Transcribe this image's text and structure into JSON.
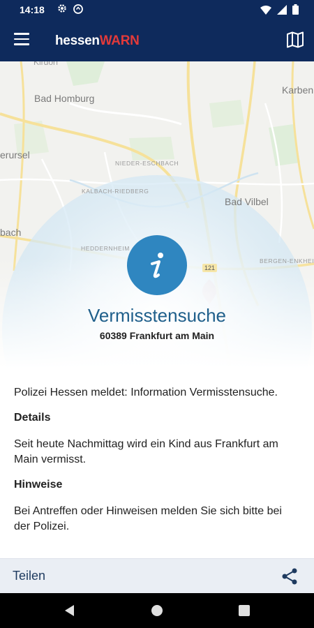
{
  "status_bar": {
    "time": "14:18"
  },
  "app_bar": {
    "logo_part1": "hessen",
    "logo_part2": "WARN"
  },
  "map": {
    "labels": {
      "bad_homburg": "Bad Homburg",
      "karben": "Karben",
      "erursel": "erursel",
      "nieder_eschbach": "NIEDER-ESCHBACH",
      "kalbach_riedberg": "KALBACH-RIEDBERG",
      "bad_vilbel": "Bad Vilbel",
      "bach": "bach",
      "heddernheim": "HEDDERNHEIM",
      "bergen_enkheim": "BERGEN-ENKHEIM",
      "road_121": "121",
      "kirdorf": "Kirdorf"
    }
  },
  "alert": {
    "title": "Vermisstensuche",
    "location": "60389 Frankfurt am Main"
  },
  "content": {
    "intro": "Polizei Hessen meldet: Information Vermisstensuche.",
    "details_heading": "Details",
    "details_text": "Seit heute Nachmittag wird ein Kind aus Frankfurt am Main vermisst.",
    "hints_heading": "Hinweise",
    "hints_text": "Bei Antreffen oder Hinweisen melden Sie sich bitte bei der Polizei."
  },
  "share_bar": {
    "label": "Teilen"
  },
  "colors": {
    "primary": "#0e2a5c",
    "accent": "#2f86c0",
    "logo_red": "#e23a3a"
  }
}
